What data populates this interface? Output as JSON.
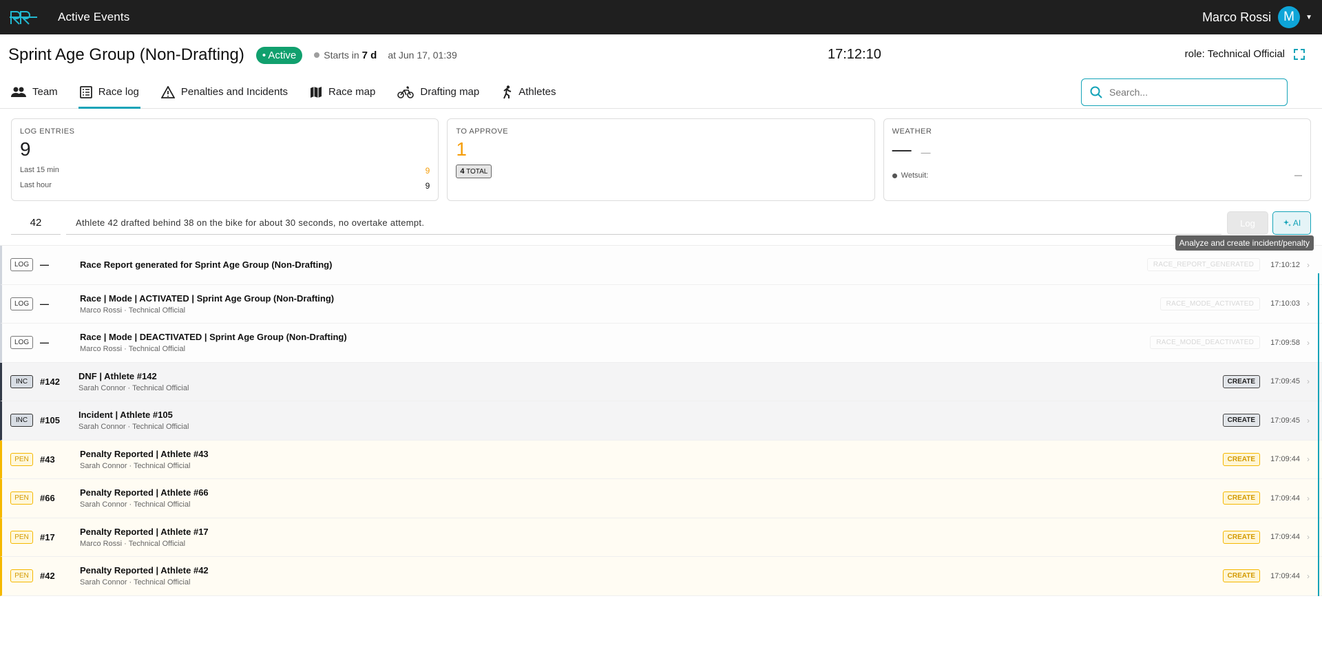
{
  "app": {
    "title": "Active Events"
  },
  "user": {
    "name": "Marco Rossi",
    "initial": "M"
  },
  "event": {
    "title": "Sprint Age Group (Non-Drafting)",
    "status": "Active",
    "starts_prefix": "Starts in",
    "starts_in": "7 d",
    "starts_at": "at Jun 17, 01:39",
    "clock": "17:12:10",
    "role": "role: Technical Official"
  },
  "tabs": [
    {
      "label": "Team",
      "icon": "people-icon"
    },
    {
      "label": "Race log",
      "icon": "list-icon",
      "active": true
    },
    {
      "label": "Penalties and Incidents",
      "icon": "warning-icon"
    },
    {
      "label": "Race map",
      "icon": "map-icon"
    },
    {
      "label": "Drafting map",
      "icon": "bike-icon"
    },
    {
      "label": "Athletes",
      "icon": "runner-icon"
    }
  ],
  "search": {
    "placeholder": "Search..."
  },
  "cards": {
    "log_entries": {
      "label": "LOG ENTRIES",
      "value": "9",
      "last15_label": "Last 15 min",
      "last15_value": "9",
      "lasthour_label": "Last hour",
      "lasthour_value": "9"
    },
    "to_approve": {
      "label": "TO APPROVE",
      "value": "1",
      "total_num": "4",
      "total_label": "TOTAL"
    },
    "weather": {
      "label": "WEATHER",
      "value": "—",
      "sub": "—",
      "wetsuit_label": "Wetsuit:",
      "wetsuit_value": "—"
    }
  },
  "log_input": {
    "athlete": "42",
    "note": "Athlete 42 drafted behind 38 on the bike for about 30 seconds, no overtake attempt.",
    "log_label": "Log",
    "ai_label": "AI",
    "tooltip": "Analyze and create incident/penalty"
  },
  "entries": [
    {
      "type": "log",
      "tag": "LOG",
      "ref": "—",
      "title": "Race Report generated for Sprint Age Group (Non-Drafting)",
      "meta": "",
      "code": "RACE_REPORT_GENERATED",
      "time": "17:10:12"
    },
    {
      "type": "log",
      "tag": "LOG",
      "ref": "—",
      "title": "Race | Mode | ACTIVATED | Sprint Age Group (Non-Drafting)",
      "meta": "Marco Rossi · Technical Official",
      "code": "RACE_MODE_ACTIVATED",
      "time": "17:10:03"
    },
    {
      "type": "log",
      "tag": "LOG",
      "ref": "—",
      "title": "Race | Mode | DEACTIVATED | Sprint Age Group (Non-Drafting)",
      "meta": "Marco Rossi · Technical Official",
      "code": "RACE_MODE_DEACTIVATED",
      "time": "17:09:58"
    },
    {
      "type": "inc",
      "tag": "INC",
      "ref": "#142",
      "title": "DNF | Athlete #142",
      "meta": "Sarah Connor · Technical Official",
      "action": "CREATE",
      "time": "17:09:45"
    },
    {
      "type": "inc",
      "tag": "INC",
      "ref": "#105",
      "title": "Incident | Athlete #105",
      "meta": "Sarah Connor · Technical Official",
      "action": "CREATE",
      "time": "17:09:45"
    },
    {
      "type": "pen",
      "tag": "PEN",
      "ref": "#43",
      "title": "Penalty Reported | Athlete #43",
      "meta": "Sarah Connor · Technical Official",
      "action": "CREATE",
      "time": "17:09:44"
    },
    {
      "type": "pen",
      "tag": "PEN",
      "ref": "#66",
      "title": "Penalty Reported | Athlete #66",
      "meta": "Sarah Connor · Technical Official",
      "action": "CREATE",
      "time": "17:09:44"
    },
    {
      "type": "pen",
      "tag": "PEN",
      "ref": "#17",
      "title": "Penalty Reported | Athlete #17",
      "meta": "Marco Rossi · Technical Official",
      "action": "CREATE",
      "time": "17:09:44"
    },
    {
      "type": "pen",
      "tag": "PEN",
      "ref": "#42",
      "title": "Penalty Reported | Athlete #42",
      "meta": "Sarah Connor · Technical Official",
      "action": "CREATE",
      "time": "17:09:44"
    }
  ]
}
